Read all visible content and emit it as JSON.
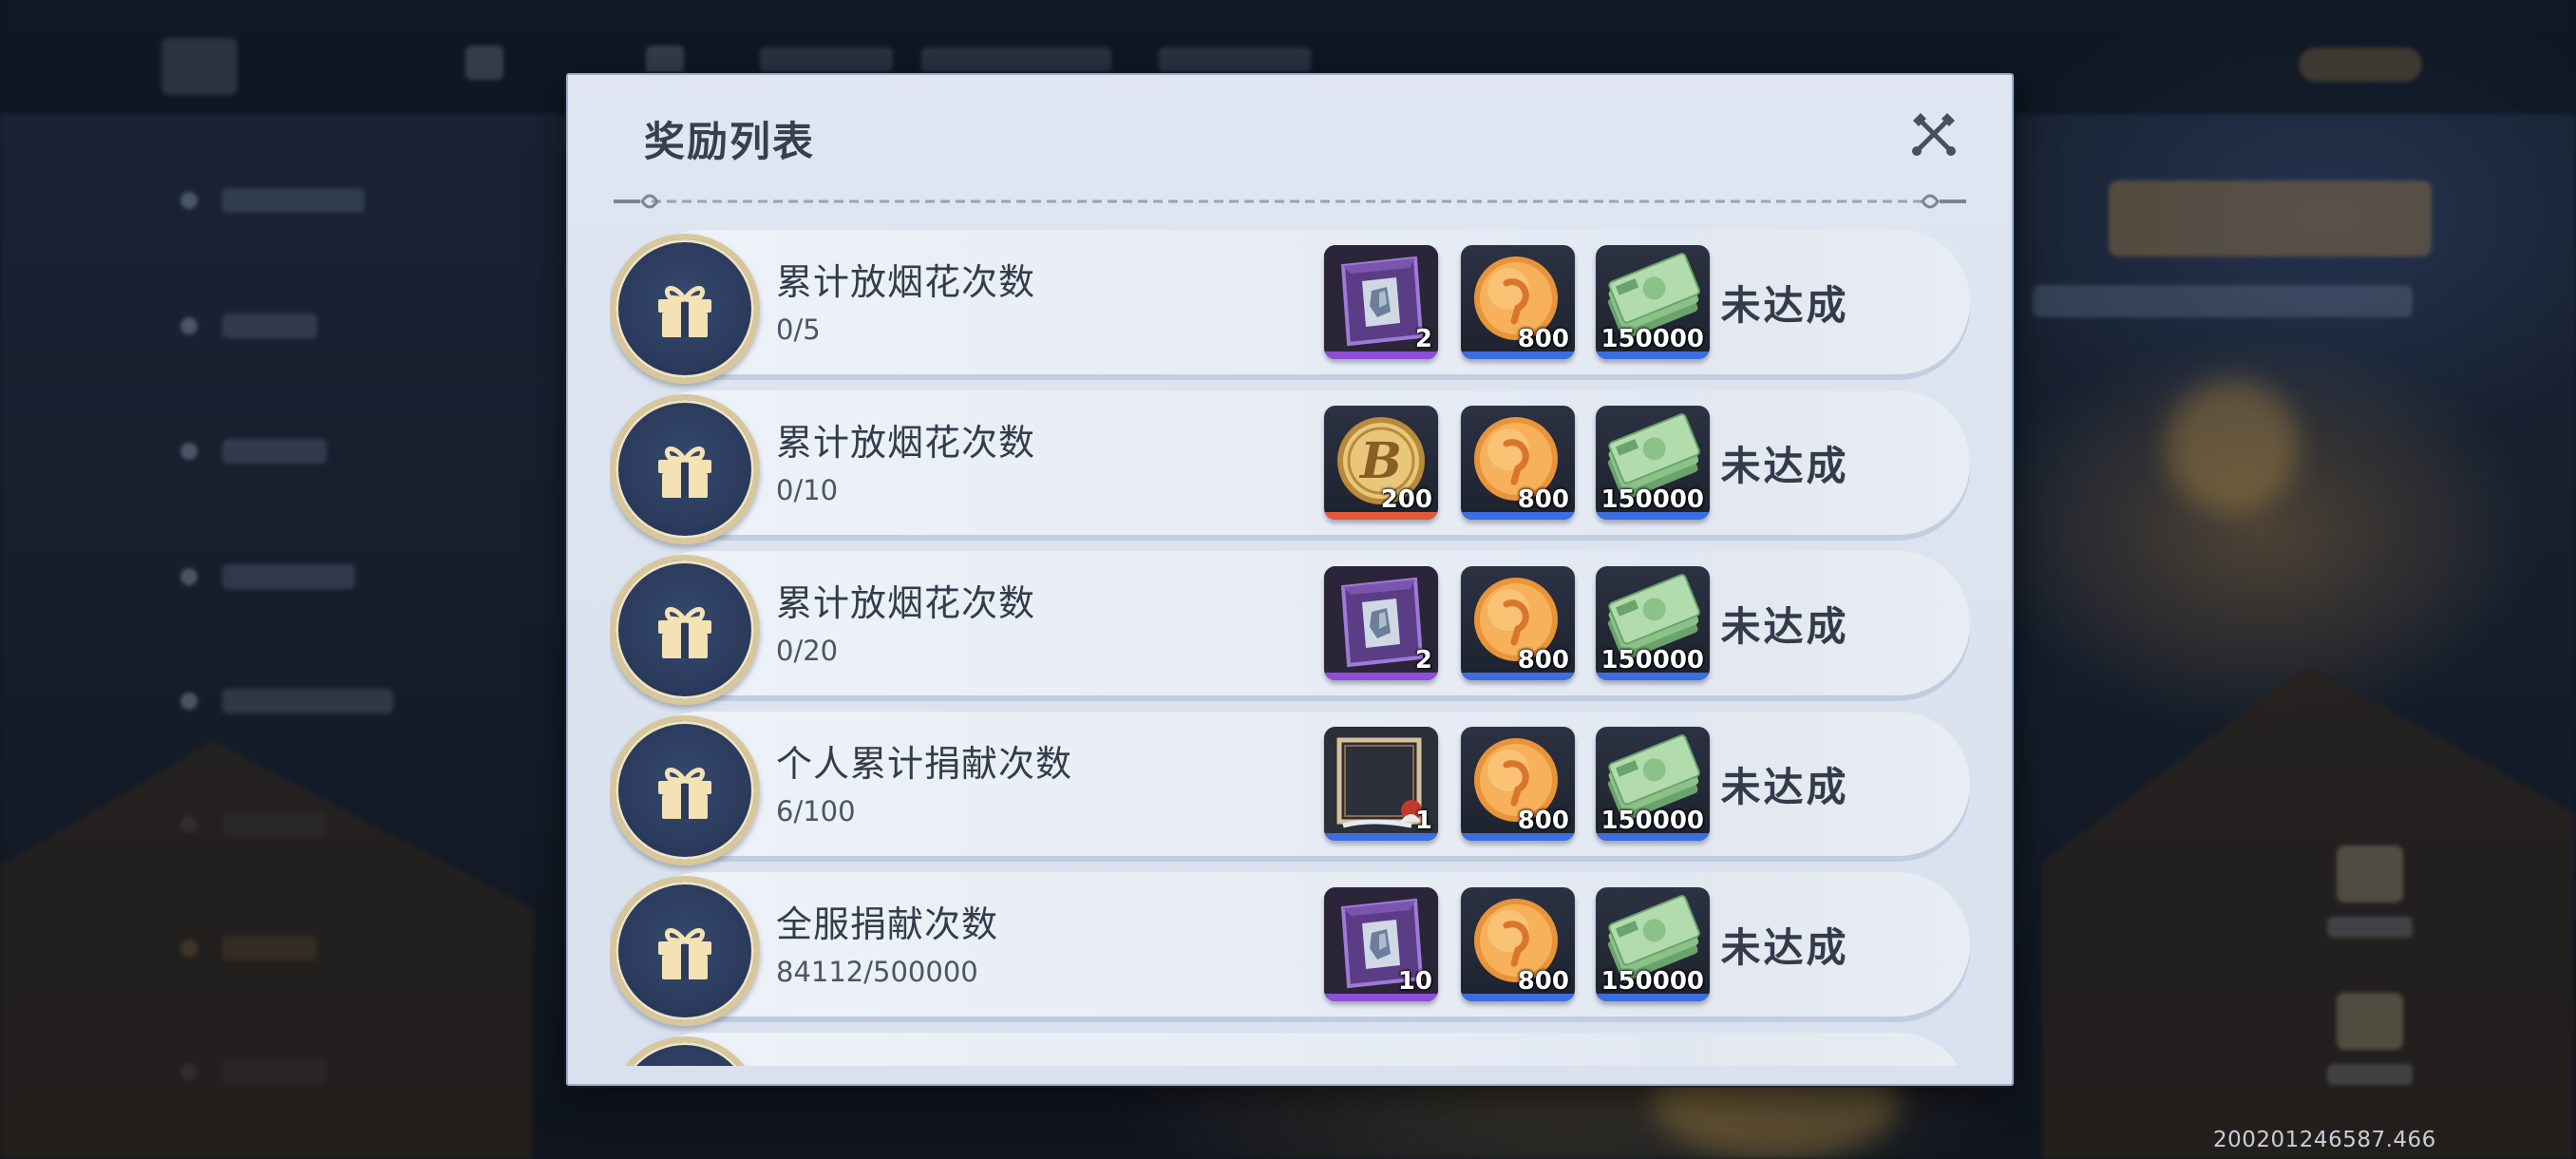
{
  "modal": {
    "title": "奖励列表",
    "close_icon": "crossed-tools-close-icon",
    "divider_icon": "ornament-divider-icon"
  },
  "rows": [
    {
      "title": "累计放烟花次数",
      "progress": "0/5",
      "status": "未达成",
      "rewards": [
        {
          "icon": "purple-crystal-crate-icon",
          "qty": "2",
          "rarity_color": "#8f4ed8"
        },
        {
          "icon": "orange-coin-icon",
          "qty": "800",
          "rarity_color": "#3b6ee0"
        },
        {
          "icon": "cash-bundle-icon",
          "qty": "150000",
          "rarity_color": "#3b6ee0"
        }
      ]
    },
    {
      "title": "累计放烟花次数",
      "progress": "0/10",
      "status": "未达成",
      "rewards": [
        {
          "icon": "gold-b-coin-icon",
          "qty": "200",
          "rarity_color": "#e05a3a"
        },
        {
          "icon": "orange-coin-icon",
          "qty": "800",
          "rarity_color": "#3b6ee0"
        },
        {
          "icon": "cash-bundle-icon",
          "qty": "150000",
          "rarity_color": "#3b6ee0"
        }
      ]
    },
    {
      "title": "累计放烟花次数",
      "progress": "0/20",
      "status": "未达成",
      "rewards": [
        {
          "icon": "purple-crystal-crate-icon",
          "qty": "2",
          "rarity_color": "#8f4ed8"
        },
        {
          "icon": "orange-coin-icon",
          "qty": "800",
          "rarity_color": "#3b6ee0"
        },
        {
          "icon": "cash-bundle-icon",
          "qty": "150000",
          "rarity_color": "#3b6ee0"
        }
      ]
    },
    {
      "title": "个人累计捐献次数",
      "progress": "6/100",
      "status": "未达成",
      "rewards": [
        {
          "icon": "avatar-frame-icon",
          "qty": "1",
          "rarity_color": "#3b6ee0"
        },
        {
          "icon": "orange-coin-icon",
          "qty": "800",
          "rarity_color": "#3b6ee0"
        },
        {
          "icon": "cash-bundle-icon",
          "qty": "150000",
          "rarity_color": "#3b6ee0"
        }
      ]
    },
    {
      "title": "全服捐献次数",
      "progress": "84112/500000",
      "status": "未达成",
      "rewards": [
        {
          "icon": "purple-crystal-crate-icon",
          "qty": "10",
          "rarity_color": "#8f4ed8"
        },
        {
          "icon": "orange-coin-icon",
          "qty": "800",
          "rarity_color": "#3b6ee0"
        },
        {
          "icon": "cash-bundle-icon",
          "qty": "150000",
          "rarity_color": "#3b6ee0"
        }
      ]
    }
  ],
  "partial_row": {
    "icon": "gift-icon"
  },
  "version": "200201246587.466"
}
